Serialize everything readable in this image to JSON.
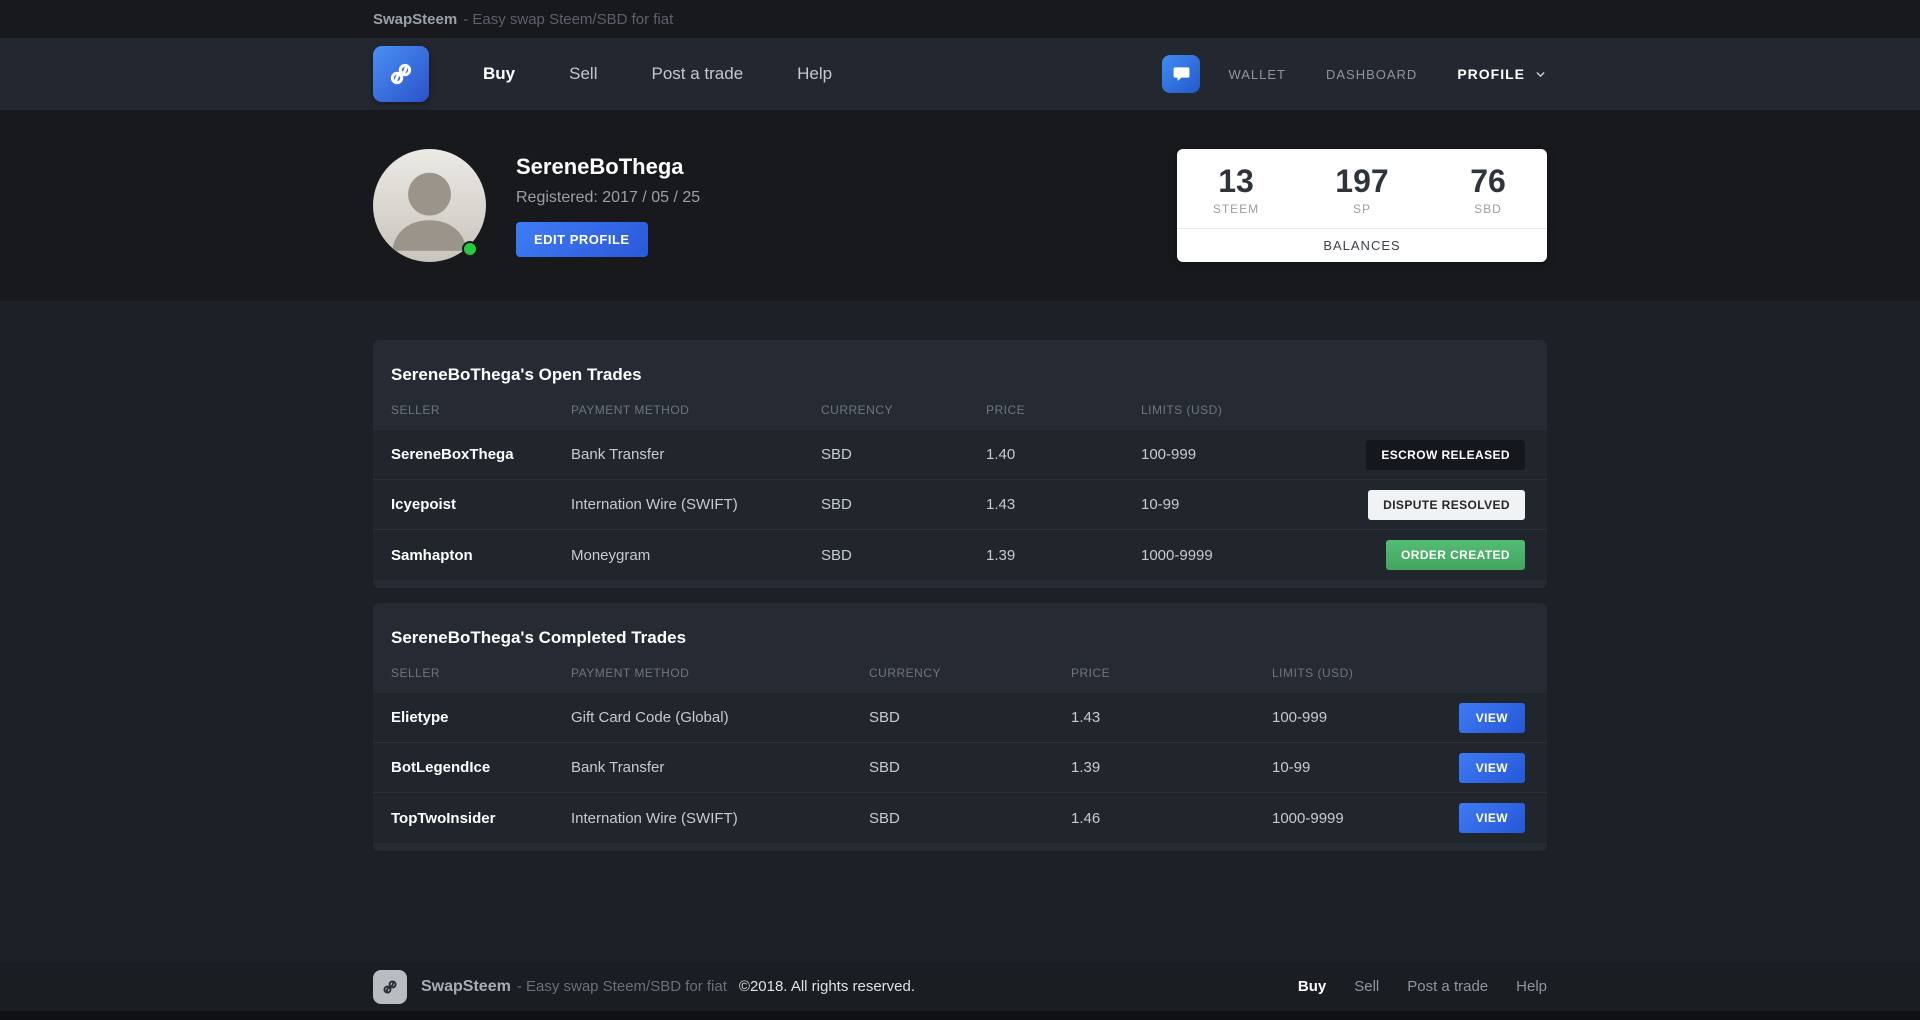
{
  "topbar": {
    "brand": "SwapSteem",
    "tagline": "- Easy swap Steem/SBD for fiat"
  },
  "nav": {
    "items": [
      {
        "label": "Buy",
        "active": true
      },
      {
        "label": "Sell",
        "active": false
      },
      {
        "label": "Post a trade",
        "active": false
      },
      {
        "label": "Help",
        "active": false
      }
    ],
    "wallet": "WALLET",
    "dashboard": "DASHBOARD",
    "profile": "PROFILE"
  },
  "profile": {
    "name": "SereneBoThega",
    "registered_label": "Registered: 2017 / 05 / 25",
    "edit_button": "EDIT PROFILE",
    "status": "online",
    "balances": {
      "title": "BALANCES",
      "items": [
        {
          "value": "13",
          "unit": "STEEM"
        },
        {
          "value": "197",
          "unit": "SP"
        },
        {
          "value": "76",
          "unit": "SBD"
        }
      ]
    }
  },
  "open_trades": {
    "title": "SereneBoThega's Open Trades",
    "headers": [
      "SELLER",
      "PAYMENT METHOD",
      "CURRENCY",
      "PRICE",
      "LIMITS (USD)"
    ],
    "rows": [
      {
        "seller": "SereneBoxThega",
        "payment": "Bank Transfer",
        "currency": "SBD",
        "price": "1.40",
        "limits": "100-999",
        "action": "ESCROW RELEASED",
        "status_style": "dark"
      },
      {
        "seller": "Icyepoist",
        "payment": "Internation Wire (SWIFT)",
        "currency": "SBD",
        "price": "1.43",
        "limits": "10-99",
        "action": "DISPUTE RESOLVED",
        "status_style": "light"
      },
      {
        "seller": "Samhapton",
        "payment": "Moneygram",
        "currency": "SBD",
        "price": "1.39",
        "limits": "1000-9999",
        "action": "ORDER CREATED",
        "status_style": "green"
      }
    ]
  },
  "completed_trades": {
    "title": "SereneBoThega's Completed Trades",
    "headers": [
      "SELLER",
      "PAYMENT METHOD",
      "CURRENCY",
      "PRICE",
      "LIMITS (USD)"
    ],
    "rows": [
      {
        "seller": "Elietype",
        "payment": "Gift Card Code (Global)",
        "currency": "SBD",
        "price": "1.43",
        "limits": "100-999",
        "action": "VIEW",
        "status_style": "blue"
      },
      {
        "seller": "BotLegendIce",
        "payment": "Bank Transfer",
        "currency": "SBD",
        "price": "1.39",
        "limits": "10-99",
        "action": "VIEW",
        "status_style": "blue"
      },
      {
        "seller": "TopTwoInsider",
        "payment": "Internation Wire (SWIFT)",
        "currency": "SBD",
        "price": "1.46",
        "limits": "1000-9999",
        "action": "VIEW",
        "status_style": "blue"
      }
    ]
  },
  "footer": {
    "brand": "SwapSteem",
    "tagline": "- Easy swap Steem/SBD for fiat",
    "copyright": "©2018. All rights reserved.",
    "links": [
      {
        "label": "Buy",
        "active": true
      },
      {
        "label": "Sell",
        "active": false
      },
      {
        "label": "Post a trade",
        "active": false
      },
      {
        "label": "Help",
        "active": false
      }
    ]
  },
  "icons": {
    "logo": "swap-69-icon",
    "chat": "chat-bubble-icon",
    "profile_caret": "chevron-down-icon",
    "avatar_status": "online-dot"
  },
  "colors": {
    "accent_blue": "#2f6fe0",
    "success_green": "#4db36a",
    "page_bg": "#1d2127",
    "header_bg": "#17191d",
    "panel_bg": "#262b33",
    "card_bg": "#ffffff"
  }
}
